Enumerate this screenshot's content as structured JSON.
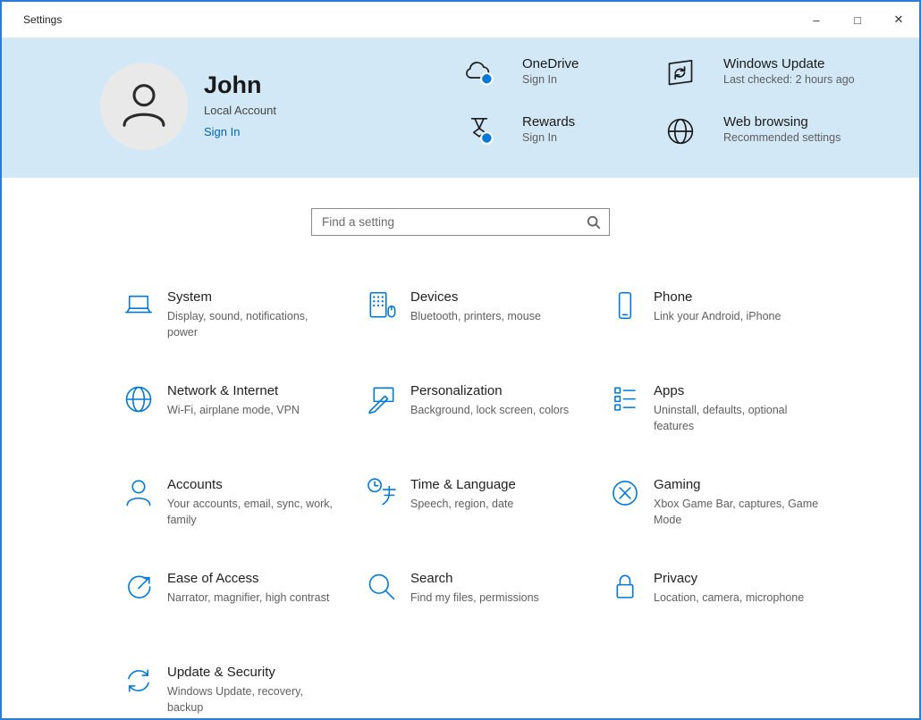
{
  "window": {
    "title": "Settings",
    "minimize_label": "–",
    "maximize_label": "□",
    "close_label": "✕"
  },
  "header": {
    "user": {
      "name": "John",
      "account_type": "Local Account",
      "sign_in_label": "Sign In"
    },
    "quick_links": [
      {
        "icon": "onedrive-cloud-icon",
        "title": "OneDrive",
        "subtitle": "Sign In"
      },
      {
        "icon": "rewards-icon",
        "title": "Rewards",
        "subtitle": "Sign In"
      },
      {
        "icon": "windows-update-icon",
        "title": "Windows Update",
        "subtitle": "Last checked: 2 hours ago"
      },
      {
        "icon": "globe-icon",
        "title": "Web browsing",
        "subtitle": "Recommended settings"
      }
    ]
  },
  "search": {
    "placeholder": "Find a setting"
  },
  "categories": [
    {
      "icon": "system-icon",
      "title": "System",
      "subtitle": "Display, sound, notifications, power"
    },
    {
      "icon": "devices-icon",
      "title": "Devices",
      "subtitle": "Bluetooth, printers, mouse"
    },
    {
      "icon": "phone-icon",
      "title": "Phone",
      "subtitle": "Link your Android, iPhone"
    },
    {
      "icon": "network-internet-icon",
      "title": "Network & Internet",
      "subtitle": "Wi-Fi, airplane mode, VPN"
    },
    {
      "icon": "personalization-icon",
      "title": "Personalization",
      "subtitle": "Background, lock screen, colors"
    },
    {
      "icon": "apps-icon",
      "title": "Apps",
      "subtitle": "Uninstall, defaults, optional features"
    },
    {
      "icon": "accounts-icon",
      "title": "Accounts",
      "subtitle": "Your accounts, email, sync, work, family"
    },
    {
      "icon": "time-language-icon",
      "title": "Time & Language",
      "subtitle": "Speech, region, date"
    },
    {
      "icon": "gaming-icon",
      "title": "Gaming",
      "subtitle": "Xbox Game Bar, captures, Game Mode"
    },
    {
      "icon": "ease-of-access-icon",
      "title": "Ease of Access",
      "subtitle": "Narrator, magnifier, high contrast"
    },
    {
      "icon": "search-category-icon",
      "title": "Search",
      "subtitle": "Find my files, permissions"
    },
    {
      "icon": "privacy-icon",
      "title": "Privacy",
      "subtitle": "Location, camera, microphone"
    },
    {
      "icon": "update-security-icon",
      "title": "Update & Security",
      "subtitle": "Windows Update, recovery, backup"
    }
  ],
  "colors": {
    "accent": "#0078d7",
    "header_background": "#d3e8f7",
    "link": "#0063b1",
    "window_border": "#2b7cd3"
  }
}
